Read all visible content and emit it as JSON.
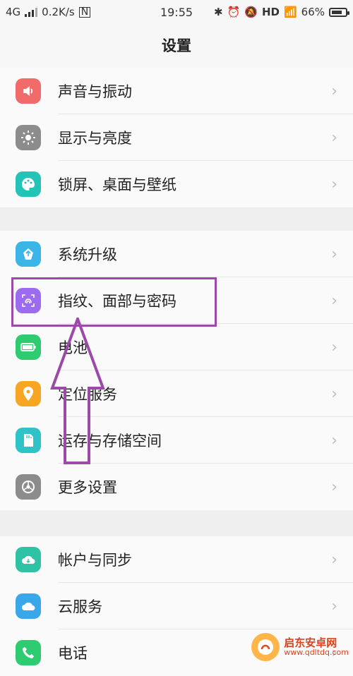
{
  "status_bar": {
    "network": "4G",
    "speed": "0.2K/s",
    "time": "19:55",
    "hd": "HD",
    "battery_percent": "66%",
    "battery_level": 0.66
  },
  "page": {
    "title": "设置"
  },
  "groups": [
    {
      "items": [
        {
          "label": "声音与振动",
          "icon": "volume-icon",
          "color": "#f26b6b"
        },
        {
          "label": "显示与亮度",
          "icon": "brightness-icon",
          "color": "#8c8c8c"
        },
        {
          "label": "锁屏、桌面与壁纸",
          "icon": "palette-icon",
          "color": "#25c2b7"
        }
      ]
    },
    {
      "items": [
        {
          "label": "系统升级",
          "icon": "update-icon",
          "color": "#3bb4e6"
        },
        {
          "label": "指纹、面部与密码",
          "icon": "fingerprint-icon",
          "color": "#9b6cf0"
        },
        {
          "label": "电池",
          "icon": "battery-icon",
          "color": "#2ecb71"
        },
        {
          "label": "定位服务",
          "icon": "location-icon",
          "color": "#f6a623"
        },
        {
          "label": "运存与存储空间",
          "icon": "storage-icon",
          "color": "#2fc3c8"
        },
        {
          "label": "更多设置",
          "icon": "gear-icon",
          "color": "#8c8c8c"
        }
      ]
    },
    {
      "items": [
        {
          "label": "帐户与同步",
          "icon": "account-sync-icon",
          "color": "#2fc3a6"
        },
        {
          "label": "云服务",
          "icon": "cloud-icon",
          "color": "#3aa7e8"
        },
        {
          "label": "电话",
          "icon": "phone-icon",
          "color": "#2ecb71"
        }
      ]
    }
  ],
  "watermark": {
    "name": "启东安卓网",
    "url": "www.qdltdq.com"
  }
}
